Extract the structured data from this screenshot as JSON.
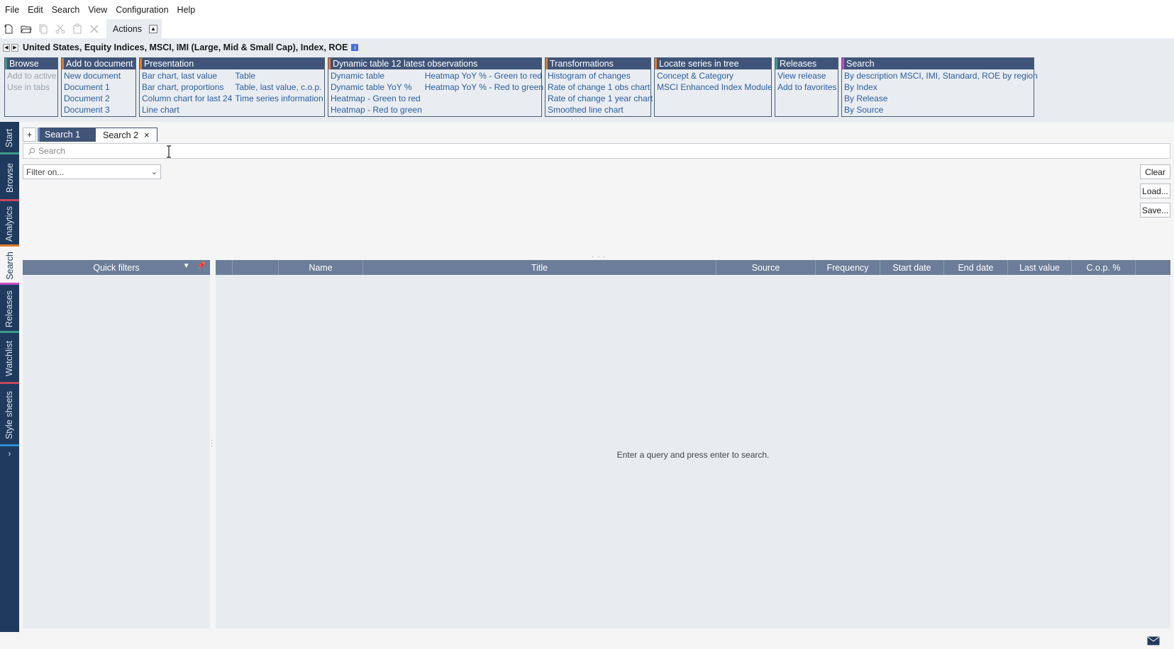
{
  "menu": [
    "File",
    "Edit",
    "Search",
    "View",
    "Configuration",
    "Help"
  ],
  "toolbar": {
    "actions_label": "Actions",
    "icons": [
      "new-document-icon",
      "open-folder-icon",
      "copy-icon",
      "cut-icon",
      "paste-icon",
      "delete-icon"
    ]
  },
  "series_title": "United States, Equity Indices, MSCI, IMI (Large, Mid & Small Cap), Index, ROE",
  "groups": {
    "browse": {
      "title": "Browse",
      "col1": [
        "Add to active",
        "Use in tabs"
      ]
    },
    "add_to_document": {
      "title": "Add to document",
      "col1": [
        "New document",
        "Document 1",
        "Document 2",
        "Document 3"
      ]
    },
    "presentation": {
      "title": "Presentation",
      "col1": [
        "Bar chart, last value",
        "Bar chart, proportions",
        "Column chart for last 24",
        "Line chart"
      ],
      "col2": [
        "Table",
        "Table, last value, c.o.p.",
        "Time series information"
      ]
    },
    "dynamic_table": {
      "title": "Dynamic table 12 latest observations",
      "col1": [
        "Dynamic table",
        "Dynamic table YoY %",
        "Heatmap - Green to red",
        "Heatmap - Red to green"
      ],
      "col2": [
        "Heatmap YoY % - Green to red",
        "Heatmap YoY % - Red to green"
      ]
    },
    "transformations": {
      "title": "Transformations",
      "col1": [
        "Histogram of changes",
        "Rate of change 1 obs chart",
        "Rate of change 1 year chart",
        "Smoothed line chart"
      ]
    },
    "locate": {
      "title": "Locate series in tree",
      "col1": [
        "Concept & Category",
        "MSCI Enhanced Index Module"
      ]
    },
    "releases": {
      "title": "Releases",
      "col1": [
        "View release",
        "Add to favorites"
      ]
    },
    "search": {
      "title": "Search",
      "col1": [
        "By description MSCI, IMI, Standard, ROE by region",
        "By Index",
        "By Release",
        "By Source"
      ]
    }
  },
  "sidebar_tabs": [
    "Start",
    "Browse",
    "Analytics",
    "Search",
    "Releases",
    "Watchlist",
    "Style sheets"
  ],
  "tabs": {
    "add": "+",
    "search1": "Search 1",
    "search2": "Search 2",
    "close": "×"
  },
  "search": {
    "placeholder": "Search"
  },
  "filter": {
    "placeholder": "Filter on..."
  },
  "buttons": {
    "clear": "Clear",
    "load": "Load...",
    "save": "Save..."
  },
  "quick_filters": {
    "title": "Quick filters"
  },
  "table": {
    "columns": [
      "",
      "",
      "Name",
      "Title",
      "Source",
      "Frequency",
      "Start date",
      "End date",
      "Last value",
      "C.o.p. %",
      ""
    ]
  },
  "empty_message": "Enter a query and press enter to search.",
  "colors": {
    "nav": "#1f3a5c",
    "header": "#3f5478",
    "link": "#2a5d9f",
    "table_header": "#6b7d98"
  }
}
